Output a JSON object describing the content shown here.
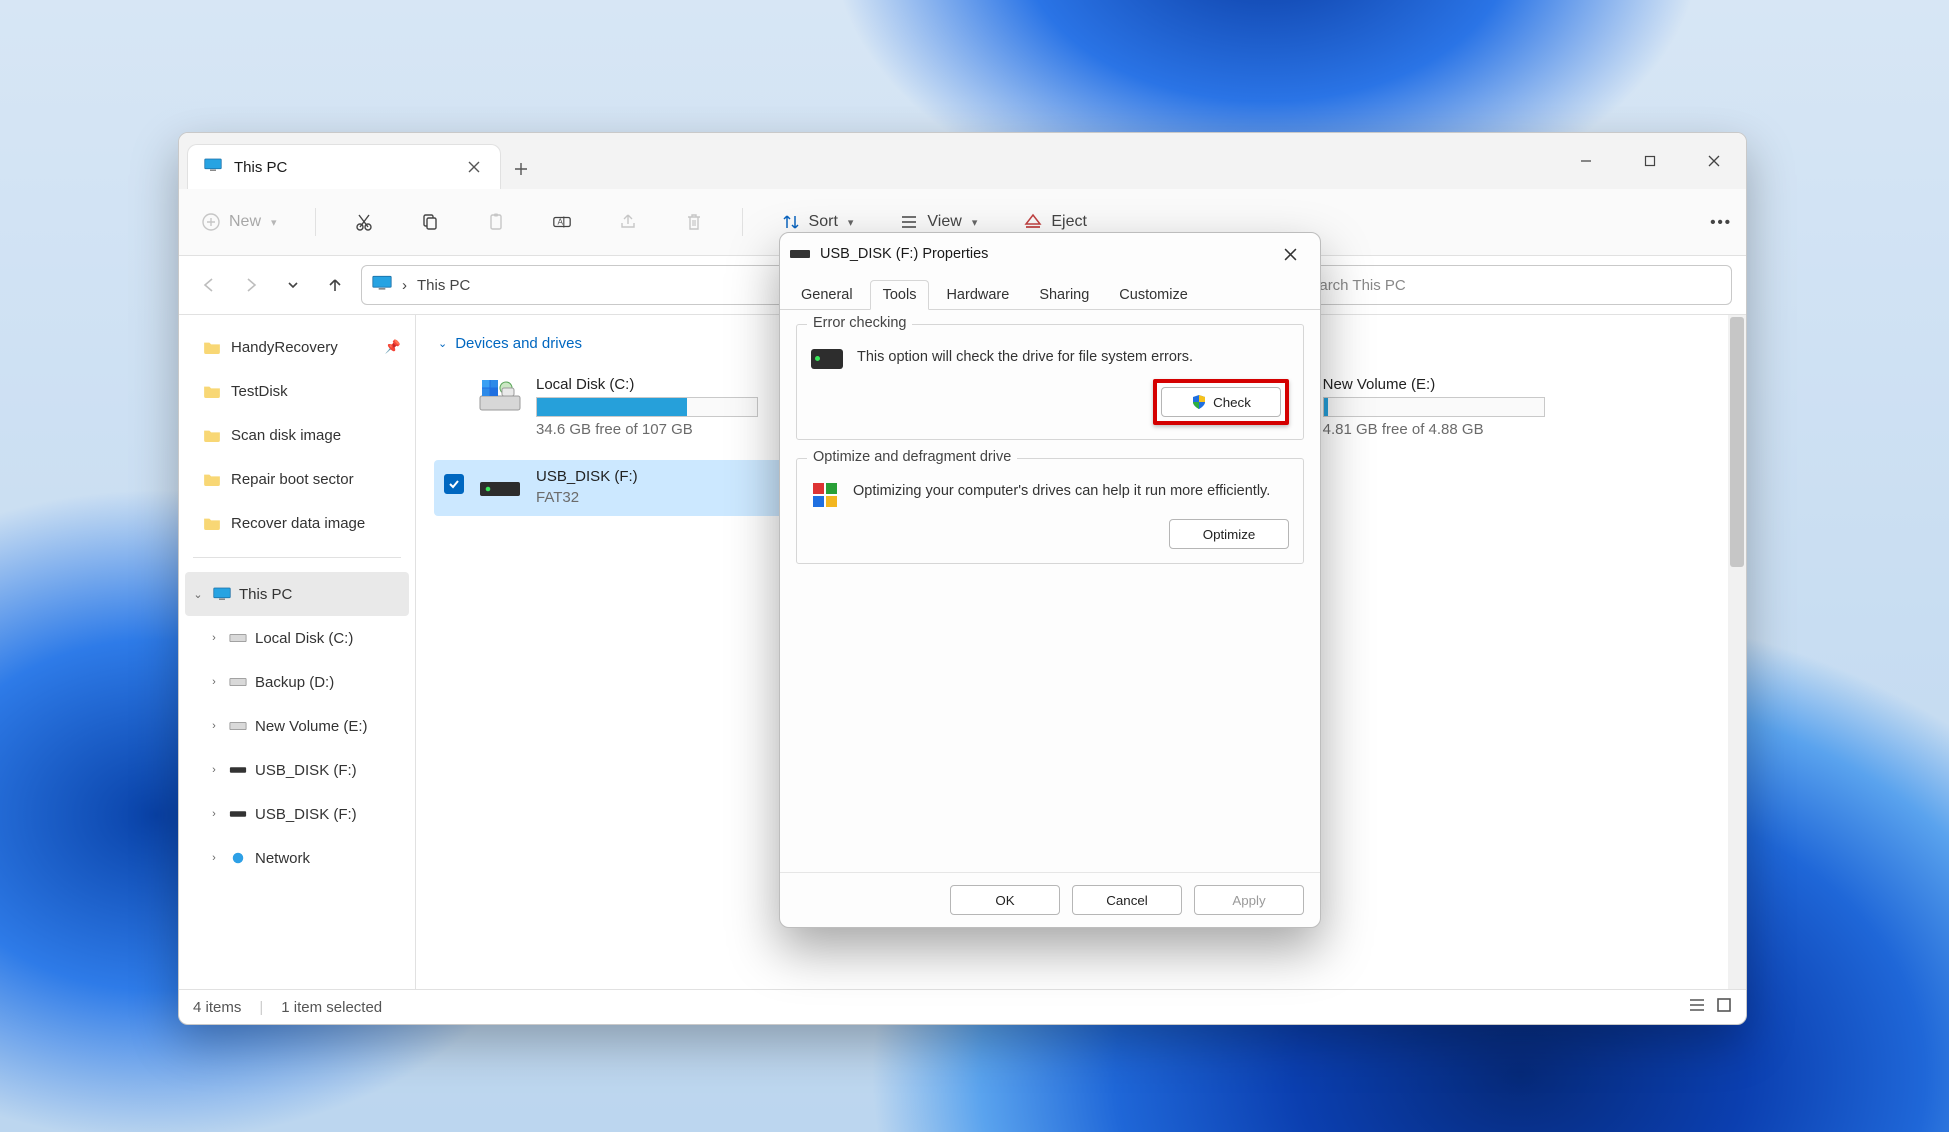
{
  "explorer": {
    "tab_title": "This PC",
    "toolbar": {
      "new_label": "New",
      "sort_label": "Sort",
      "view_label": "View",
      "eject_label": "Eject"
    },
    "breadcrumb": {
      "root_icon": "pc",
      "sep": "›",
      "current": "This PC"
    },
    "search_placeholder": "Search This PC",
    "sidebar_quick": [
      {
        "label": "HandyRecovery",
        "pinned": true
      },
      {
        "label": "TestDisk",
        "pinned": false
      },
      {
        "label": "Scan disk image",
        "pinned": false
      },
      {
        "label": "Repair boot sector",
        "pinned": false
      },
      {
        "label": "Recover data image",
        "pinned": false
      }
    ],
    "sidebar_tree": {
      "root": "This PC",
      "children": [
        {
          "label": "Local Disk (C:)"
        },
        {
          "label": "Backup (D:)"
        },
        {
          "label": "New Volume (E:)"
        },
        {
          "label": "USB_DISK (F:)"
        },
        {
          "label": "USB_DISK (F:)"
        }
      ],
      "network": "Network"
    },
    "group_header": "Devices and drives",
    "drives": [
      {
        "name": "Local Disk (C:)",
        "free": "34.6 GB free of 107 GB",
        "fill_pct": 68,
        "selected": false,
        "type": "system"
      },
      {
        "name": "New Volume (E:)",
        "free": "4.81 GB free of 4.88 GB",
        "fill_pct": 2,
        "selected": false,
        "type": "hdd"
      },
      {
        "name": "USB_DISK (F:)",
        "sub": "FAT32",
        "free": "",
        "fill_pct": 0,
        "selected": true,
        "type": "usb"
      }
    ],
    "status": {
      "items": "4 items",
      "selected": "1 item selected"
    }
  },
  "dialog": {
    "title": "USB_DISK (F:) Properties",
    "tabs": [
      "General",
      "Tools",
      "Hardware",
      "Sharing",
      "Customize"
    ],
    "active_tab": "Tools",
    "error_check": {
      "legend": "Error checking",
      "text": "This option will check the drive for file system errors.",
      "button": "Check"
    },
    "optimize": {
      "legend": "Optimize and defragment drive",
      "text": "Optimizing your computer's drives can help it run more efficiently.",
      "button": "Optimize"
    },
    "actions": {
      "ok": "OK",
      "cancel": "Cancel",
      "apply": "Apply"
    }
  }
}
